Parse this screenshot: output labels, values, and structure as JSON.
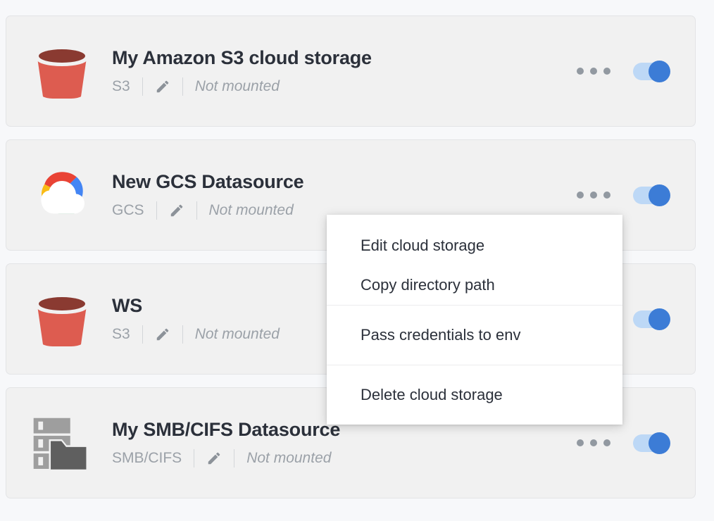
{
  "theme": {
    "page_background": "#f7f8fa",
    "card_background": "#f1f1f1",
    "card_border": "#e3e4e6",
    "title_color": "#2b303a",
    "muted_text_color": "#9ba1a8",
    "toggle_track_color": "#bdd8f6",
    "toggle_knob_color": "#3c7cd6",
    "menu_background": "#ffffff",
    "s3_bucket_body_color": "#dd5c50",
    "s3_bucket_rim_color": "#8a3a31",
    "smb_server_color": "#9e9e9e",
    "smb_folder_color": "#5f5f5f"
  },
  "storages": [
    {
      "icon": "s3-bucket-icon",
      "title": "My Amazon S3 cloud storage",
      "type": "S3",
      "edit_icon": "pencil-icon",
      "status": "Not mounted",
      "more_icon": "more-horizontal-icon",
      "enabled": true
    },
    {
      "icon": "google-cloud-icon",
      "title": "New GCS Datasource",
      "type": "GCS",
      "edit_icon": "pencil-icon",
      "status": "Not mounted",
      "more_icon": "more-horizontal-icon",
      "enabled": true
    },
    {
      "icon": "s3-bucket-icon",
      "title": "WS",
      "type": "S3",
      "edit_icon": "pencil-icon",
      "status": "Not mounted",
      "more_icon": "more-horizontal-icon",
      "enabled": true
    },
    {
      "icon": "smb-server-folder-icon",
      "title": "My SMB/CIFS Datasource",
      "type": "SMB/CIFS",
      "edit_icon": "pencil-icon",
      "status": "Not mounted",
      "more_icon": "more-horizontal-icon",
      "enabled": true
    }
  ],
  "context_menu": {
    "visible": true,
    "groups": [
      {
        "items": [
          {
            "label": "Edit cloud storage"
          },
          {
            "label": "Copy directory path"
          }
        ]
      },
      {
        "items": [
          {
            "label": "Pass credentials to env"
          }
        ]
      },
      {
        "items": [
          {
            "label": "Delete cloud storage"
          }
        ]
      }
    ]
  }
}
